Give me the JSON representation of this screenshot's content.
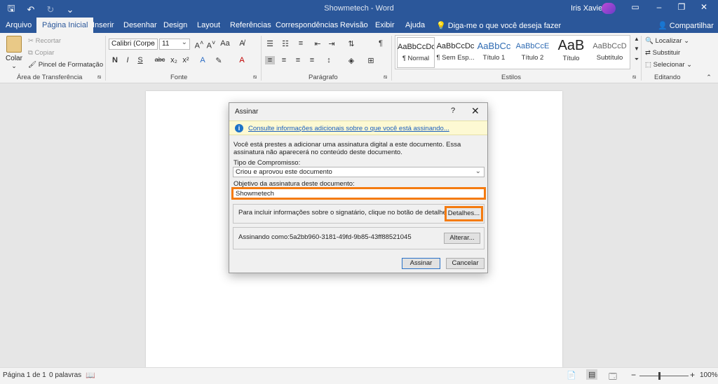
{
  "titlebar": {
    "doc_title": "Showmetech - Word",
    "user": "Iris Xavier",
    "save_icon": "save-icon",
    "undo_icon": "undo-icon",
    "redo_icon": "redo-icon",
    "customize_icon": "customize-qat-icon"
  },
  "tabs": [
    "Arquivo",
    "Página Inicial",
    "Inserir",
    "Desenhar",
    "Design",
    "Layout",
    "Referências",
    "Correspondências",
    "Revisão",
    "Exibir",
    "Ajuda"
  ],
  "tell_me": "Diga-me o que você deseja fazer",
  "share": "Compartilhar",
  "ribbon": {
    "clipboard": {
      "paste": "Colar",
      "cut": "Recortar",
      "copy": "Copiar",
      "format_painter": "Pincel de Formatação",
      "label": "Área de Transferência"
    },
    "font": {
      "name": "Calibri (Corpo",
      "size": "11",
      "label": "Fonte",
      "bold": "N",
      "italic": "I",
      "underline": "S",
      "strike": "abc"
    },
    "paragraph": {
      "label": "Parágrafo",
      "pilcrow": "¶"
    },
    "styles": {
      "label": "Estilos",
      "items": [
        {
          "preview": "AaBbCcDc",
          "name": "¶ Normal"
        },
        {
          "preview": "AaBbCcDc",
          "name": "¶ Sem Esp..."
        },
        {
          "preview": "AaBbCc",
          "name": "Título 1"
        },
        {
          "preview": "AaBbCcE",
          "name": "Título 2"
        },
        {
          "preview": "AaB",
          "name": "Título"
        },
        {
          "preview": "AaBbCcD",
          "name": "Subtítulo"
        }
      ]
    },
    "editing": {
      "find": "Localizar",
      "replace": "Substituir",
      "select": "Selecionar",
      "label": "Editando"
    }
  },
  "status": {
    "page": "Página 1 de 1",
    "words": "0 palavras",
    "zoom": "100%"
  },
  "dialog": {
    "title": "Assinar",
    "help": "?",
    "close": "✕",
    "info_link": "Consulte informações adicionais sobre o que você está assinando...",
    "description": "Você está prestes a adicionar uma assinatura digital a este documento. Essa assinatura não aparecerá no conteúdo deste documento.",
    "commitment_label": "Tipo de Compromisso:",
    "commitment_value": "Criou e aprovou este documento",
    "purpose_label": "Objetivo da assinatura deste documento:",
    "purpose_value": "Showmetech",
    "details_text": "Para incluir informações sobre o signatário, clique no botão de detalhes.",
    "details_button": "Detalhes...",
    "signing_as_label": "Assinando como:",
    "signing_as_value": "5a2bb960-3181-49fd-9b85-43ff88521045",
    "change_button": "Alterar...",
    "sign_button": "Assinar",
    "cancel_button": "Cancelar"
  }
}
